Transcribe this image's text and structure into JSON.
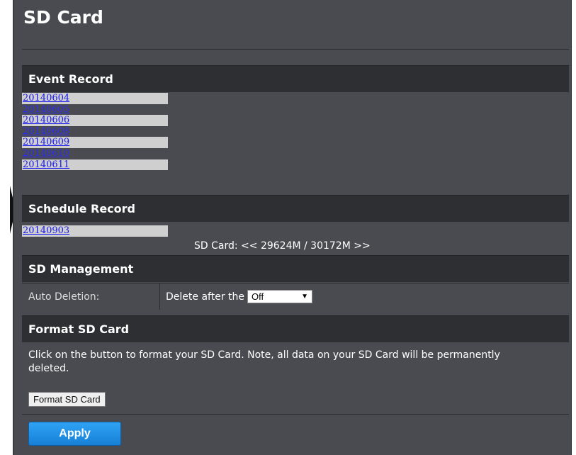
{
  "page": {
    "title": "SD Card"
  },
  "event_record": {
    "header": "Event Record",
    "items": [
      "20140604",
      "20140605",
      "20140606",
      "20140608",
      "20140609",
      "20140610",
      "20140611"
    ]
  },
  "schedule_record": {
    "header": "Schedule Record",
    "items": [
      "20140903"
    ]
  },
  "sd_status": "SD Card: << 29624M / 30172M >>",
  "sd_management": {
    "header": "SD Management",
    "auto_deletion_label": "Auto Deletion:",
    "delete_prefix": "Delete after the",
    "delete_value": "Off",
    "dropdown_icon": "triangle-down"
  },
  "format_sd": {
    "header": "Format SD Card",
    "description": "Click on the button to format your SD Card. Note, all data on your SD Card will be permanently deleted.",
    "button_label": "Format SD Card"
  },
  "apply_label": "Apply",
  "colors": {
    "background": "#4a4b51",
    "header": "#2e2f33",
    "link": "#1a1aee",
    "apply_button": "#1f8fe6"
  }
}
